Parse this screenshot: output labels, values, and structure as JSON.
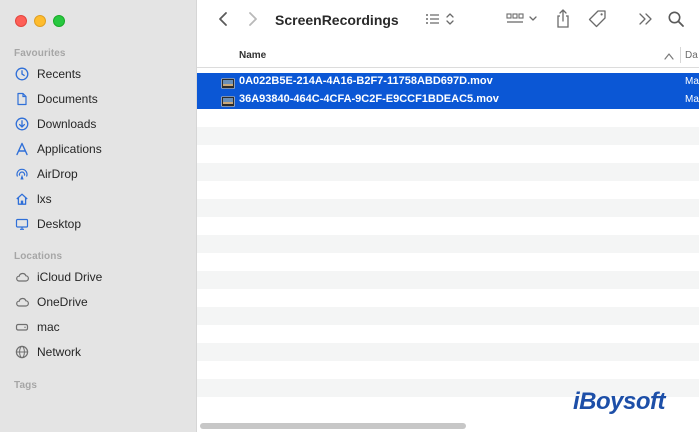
{
  "toolbar": {
    "title": "ScreenRecordings",
    "back_icon": "chevron-left-icon",
    "forward_icon": "chevron-right-icon",
    "list_view_icon": "list-view-icon",
    "grid_view_icon": "grid-view-icon",
    "share_icon": "share-icon",
    "tag_icon": "tag-icon",
    "more_icon": "double-chevron-icon",
    "search_icon": "search-icon"
  },
  "sidebar": {
    "favourites_title": "Favourites",
    "favourites": [
      {
        "label": "Recents",
        "icon": "clock-icon"
      },
      {
        "label": "Documents",
        "icon": "document-icon"
      },
      {
        "label": "Downloads",
        "icon": "download-icon"
      },
      {
        "label": "Applications",
        "icon": "applications-icon"
      },
      {
        "label": "AirDrop",
        "icon": "airdrop-icon"
      },
      {
        "label": "lxs",
        "icon": "home-icon"
      },
      {
        "label": "Desktop",
        "icon": "desktop-icon"
      }
    ],
    "locations_title": "Locations",
    "locations": [
      {
        "label": "iCloud Drive",
        "icon": "cloud-icon"
      },
      {
        "label": "OneDrive",
        "icon": "cloud-icon"
      },
      {
        "label": "mac",
        "icon": "drive-icon"
      },
      {
        "label": "Network",
        "icon": "globe-icon"
      }
    ],
    "tags_title": "Tags"
  },
  "columns": {
    "name": "Name",
    "date": "Da"
  },
  "files": [
    {
      "name": "0A022B5E-214A-4A16-B2F7-11758ABD697D.mov",
      "kind": "Ma",
      "selected": true
    },
    {
      "name": "36A93840-464C-4CFA-9C2F-E9CCF1BDEAC5.mov",
      "kind": "Ma",
      "selected": true
    }
  ],
  "watermark": "iBoysoft",
  "colors": {
    "selection": "#0b57d5",
    "sidebar_bg": "#e4e4e4"
  }
}
